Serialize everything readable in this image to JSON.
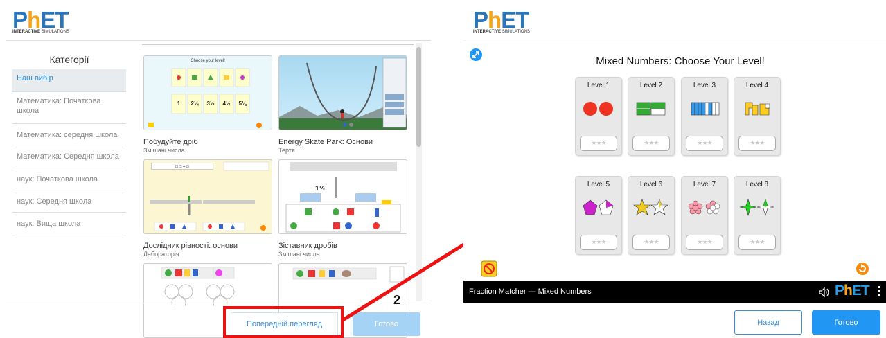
{
  "logo": {
    "letters": [
      "P",
      "h",
      "ET"
    ],
    "tagline_bold": "INTERACTIVE",
    "tagline": "SIMULATIONS"
  },
  "sidebar": {
    "title": "Категорії",
    "items": [
      {
        "label": "Наш вибір",
        "active": true
      },
      {
        "label": "Математика: Початкова школа"
      },
      {
        "label": "Математика: середня школа"
      },
      {
        "label": "Математика: Середня школа"
      },
      {
        "label": "наук: Початкова школа"
      },
      {
        "label": "наук: Середня школа"
      },
      {
        "label": "наук: Вища школа"
      }
    ]
  },
  "cards": [
    {
      "title": "Побудуйте дріб",
      "subtitle": "Змішані числа",
      "thumb_heading": "Choose your level!",
      "thumb_fracs": [
        "1",
        "2¼",
        "3⅓",
        "4½",
        "5⅛"
      ]
    },
    {
      "title": "Energy Skate Park: Основи",
      "subtitle": "Тертя"
    },
    {
      "title": "Дослідник рівності: основи",
      "subtitle": "Лабораторія",
      "thumb_eq": "□ □ = □"
    },
    {
      "title": "Зіставник дробів",
      "subtitle": "Змішані числа",
      "thumb_frac": "1⅓"
    },
    {
      "title": "",
      "subtitle": ""
    },
    {
      "title": "",
      "subtitle": ""
    }
  ],
  "buttons": {
    "preview": "Попередній перегляд",
    "done_left": "Готово",
    "back": "Назад",
    "done_right": "Готово"
  },
  "sim": {
    "title": "Mixed Numbers: Choose Your Level!",
    "bar_name": "Fraction Matcher — Mixed Numbers",
    "levels": [
      "Level 1",
      "Level 2",
      "Level 3",
      "Level 4",
      "Level 5",
      "Level 6",
      "Level 7",
      "Level 8"
    ],
    "stars": "★★★"
  },
  "colors": {
    "accent": "#2196f3",
    "highlight": "#ee1111",
    "active_sidebar_text": "#2a8fd8"
  }
}
